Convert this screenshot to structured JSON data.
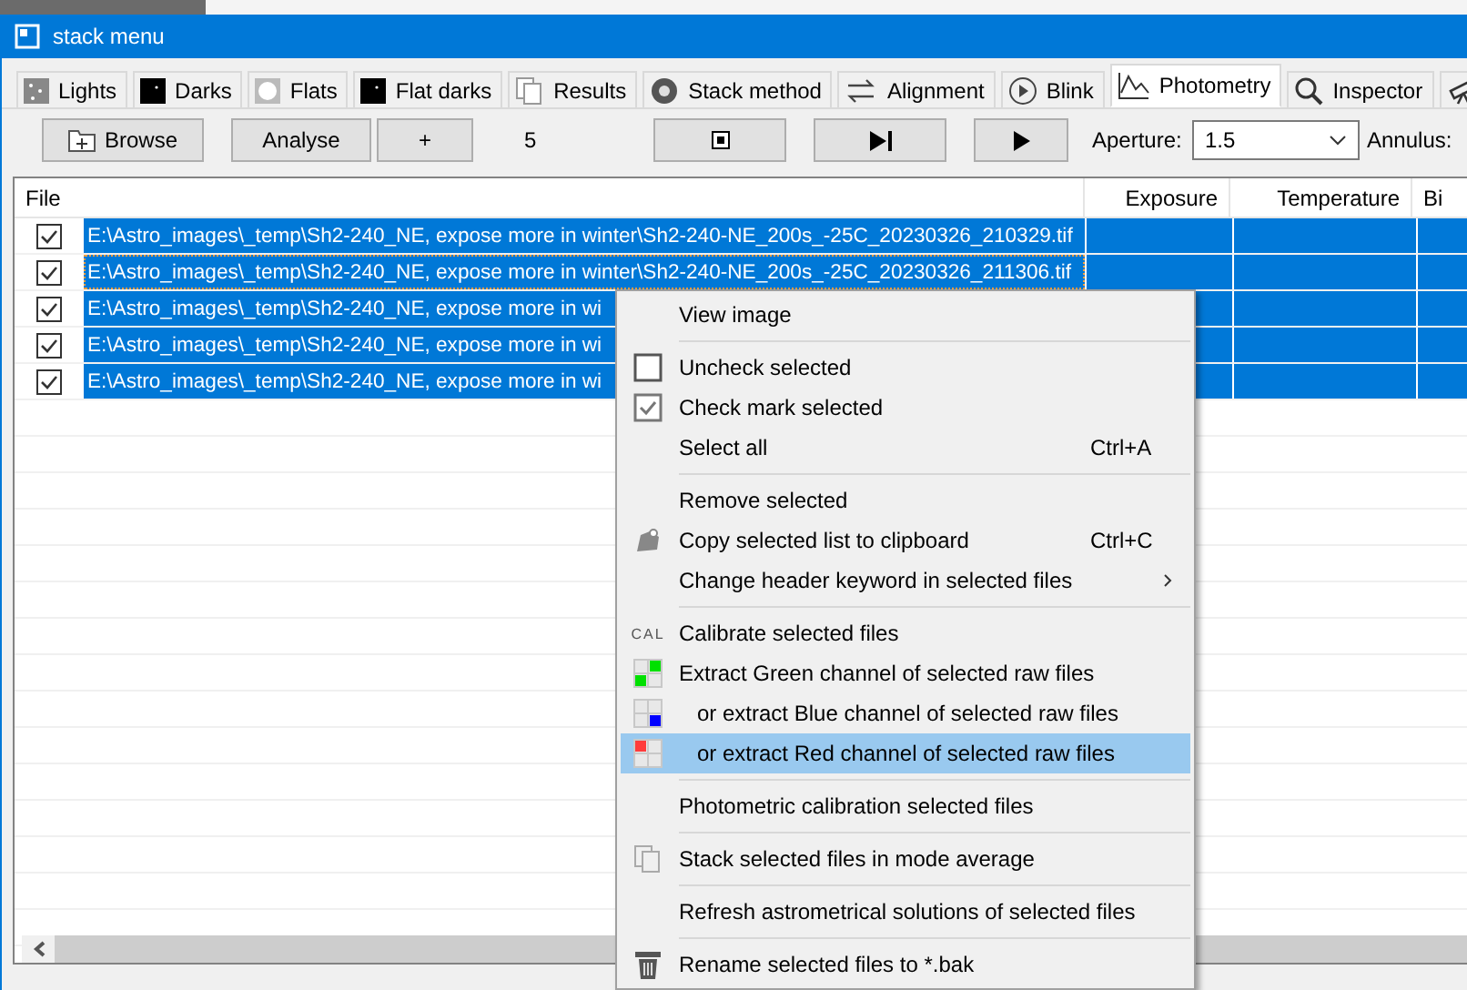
{
  "window": {
    "title": "stack menu"
  },
  "tabs": [
    {
      "label": "Lights",
      "selected": false
    },
    {
      "label": "Darks",
      "selected": false
    },
    {
      "label": "Flats",
      "selected": false
    },
    {
      "label": "Flat darks",
      "selected": false
    },
    {
      "label": "Results",
      "selected": false
    },
    {
      "label": "Stack method",
      "selected": false
    },
    {
      "label": "Alignment",
      "selected": false
    },
    {
      "label": "Blink",
      "selected": false
    },
    {
      "label": "Photometry",
      "selected": true
    },
    {
      "label": "Inspector",
      "selected": false
    },
    {
      "selected": false
    }
  ],
  "toolbar": {
    "browse": "Browse",
    "analyse": "Analyse",
    "plus": "+",
    "count": "5",
    "aperture_label": "Aperture:",
    "aperture_value": "1.5",
    "annulus_label": "Annulus:"
  },
  "table": {
    "columns": [
      "File",
      "Exposure",
      "Temperature",
      "Bi"
    ],
    "rows": [
      {
        "file": "E:\\Astro_images\\_temp\\Sh2-240_NE, expose more in winter\\Sh2-240-NE_200s_-25C_20230326_210329.tif",
        "checked": true,
        "selected": true,
        "focused": false
      },
      {
        "file": "E:\\Astro_images\\_temp\\Sh2-240_NE, expose more in winter\\Sh2-240-NE_200s_-25C_20230326_211306.tif",
        "checked": true,
        "selected": true,
        "focused": true
      },
      {
        "file": "E:\\Astro_images\\_temp\\Sh2-240_NE, expose more in wi",
        "checked": true,
        "selected": true,
        "focused": false
      },
      {
        "file": "E:\\Astro_images\\_temp\\Sh2-240_NE, expose more in wi",
        "checked": true,
        "selected": true,
        "focused": false
      },
      {
        "file": "E:\\Astro_images\\_temp\\Sh2-240_NE, expose more in wi",
        "checked": true,
        "selected": true,
        "focused": false
      }
    ]
  },
  "context_menu": [
    {
      "kind": "item",
      "label": "View image",
      "highlighted": false
    },
    {
      "kind": "separator"
    },
    {
      "kind": "item",
      "label": "Uncheck selected",
      "highlighted": false
    },
    {
      "kind": "item",
      "label": "Check mark selected",
      "highlighted": false
    },
    {
      "kind": "item",
      "label": "Select all",
      "shortcut": "Ctrl+A",
      "highlighted": false
    },
    {
      "kind": "separator"
    },
    {
      "kind": "item",
      "label": "Remove selected",
      "highlighted": false
    },
    {
      "kind": "item",
      "label": "Copy selected list to clipboard",
      "shortcut": "Ctrl+C",
      "highlighted": false
    },
    {
      "kind": "item",
      "label": "Change header keyword in selected files",
      "submenu": true,
      "highlighted": false
    },
    {
      "kind": "separator"
    },
    {
      "kind": "item",
      "label": "Calibrate selected files",
      "icon_text": "CAL",
      "highlighted": false
    },
    {
      "kind": "item",
      "label": "Extract Green channel of selected raw files",
      "highlighted": false
    },
    {
      "kind": "item",
      "label": "or extract Blue channel of selected raw files",
      "indented": true,
      "highlighted": false
    },
    {
      "kind": "item",
      "label": "or extract Red channel of selected raw files",
      "indented": true,
      "highlighted": true
    },
    {
      "kind": "separator"
    },
    {
      "kind": "item",
      "label": "Photometric calibration selected files",
      "highlighted": false
    },
    {
      "kind": "separator"
    },
    {
      "kind": "item",
      "label": "Stack selected files in mode average",
      "highlighted": false
    },
    {
      "kind": "separator"
    },
    {
      "kind": "item",
      "label": "Refresh astrometrical solutions of selected files",
      "highlighted": false
    },
    {
      "kind": "separator"
    },
    {
      "kind": "item",
      "label": "Rename selected files to *.bak",
      "highlighted": false
    }
  ]
}
